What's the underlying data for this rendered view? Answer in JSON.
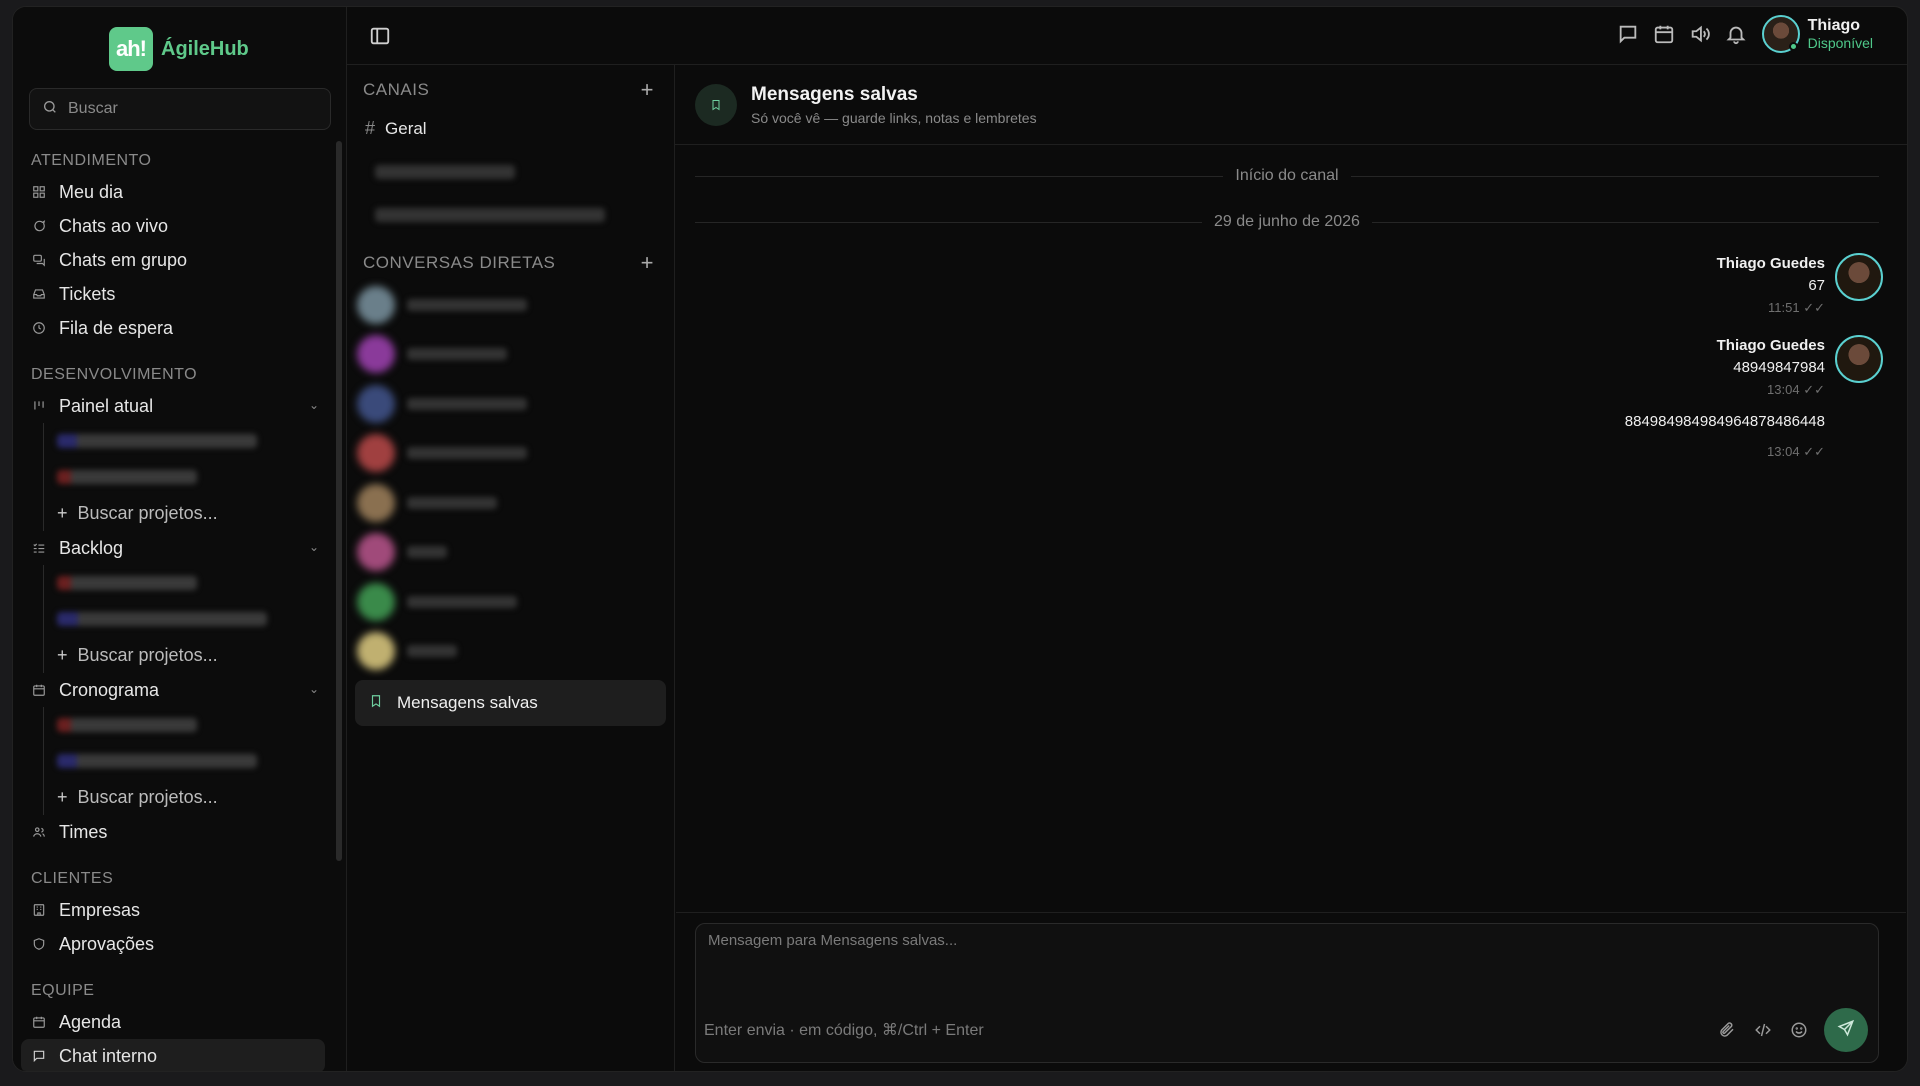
{
  "app": {
    "logo_badge": "ah!",
    "logo_text": "ÁgileHub"
  },
  "search": {
    "placeholder": "Buscar"
  },
  "sidebar": {
    "sections": {
      "atendimento": "ATENDIMENTO",
      "desenvolvimento": "DESENVOLVIMENTO",
      "clientes": "CLIENTES",
      "equipe": "EQUIPE"
    },
    "items": {
      "meu_dia": "Meu dia",
      "chats_ao_vivo": "Chats ao vivo",
      "chats_em_grupo": "Chats em grupo",
      "tickets": "Tickets",
      "fila_de_espera": "Fila de espera",
      "painel_atual": "Painel atual",
      "backlog": "Backlog",
      "cronograma": "Cronograma",
      "times": "Times",
      "empresas": "Empresas",
      "aprovacoes": "Aprovações",
      "agenda": "Agenda",
      "chat_interno": "Chat interno"
    },
    "buscar_projetos": "Buscar projetos..."
  },
  "user": {
    "name": "Thiago",
    "status": "Disponível"
  },
  "channels": {
    "canais_header": "CANAIS",
    "geral": "Geral",
    "dm_header": "CONVERSAS DIRETAS",
    "saved": "Mensagens salvas"
  },
  "chat": {
    "title": "Mensagens salvas",
    "subtitle": "Só você vê — guarde links, notas e lembretes",
    "start": "Início do canal",
    "date": "29 de junho de 2026",
    "messages": [
      {
        "author": "Thiago Guedes",
        "text": "67",
        "time": "11:51"
      },
      {
        "author": "Thiago Guedes",
        "text": "48949847984",
        "time": "13:04"
      },
      {
        "author": "",
        "text": "884984984984964878486448",
        "time": "13:04"
      }
    ],
    "composer_placeholder": "Mensagem para Mensagens salvas...",
    "hint": "Enter envia · em código, ⌘/Ctrl + Enter"
  },
  "colors": {
    "accent": "#5fc98a",
    "online": "#4fc88a",
    "avatar_ring": "#5ad0d0"
  }
}
